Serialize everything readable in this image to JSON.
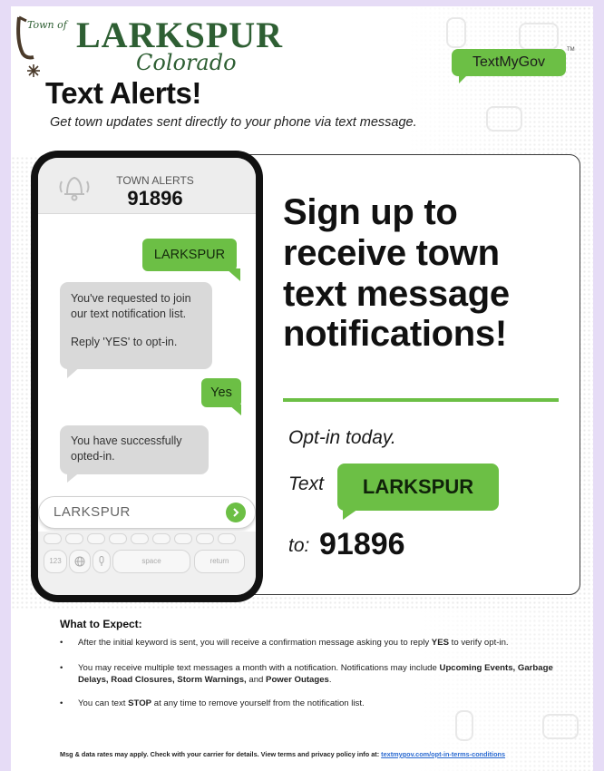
{
  "header": {
    "town_prefix": "Town of",
    "town_name": "LARKSPUR",
    "state": "Colorado",
    "title": "Text Alerts!",
    "subtitle": "Get town updates sent directly to your phone via text message.",
    "brand": "TextMyGov",
    "brand_tm": "TM"
  },
  "phone": {
    "alerts_label": "TOWN ALERTS",
    "shortcode": "91896",
    "messages": [
      {
        "from": "user",
        "text": "LARKSPUR"
      },
      {
        "from": "town",
        "text": "You've requested to join our text notification list.",
        "text2": "Reply 'YES' to opt-in."
      },
      {
        "from": "user",
        "text": "Yes"
      },
      {
        "from": "town",
        "text": "You have successfully opted-in."
      }
    ],
    "input_value": "LARKSPUR",
    "keys": {
      "num": "123",
      "space": "space",
      "return": "return"
    }
  },
  "signup": {
    "headline_lines": [
      "Sign up to",
      "receive town",
      "text message",
      "notifications!"
    ],
    "optin": "Opt-in today.",
    "text_label": "Text",
    "keyword": "LARKSPUR",
    "to_label": "to:",
    "number": "91896"
  },
  "expect": {
    "title": "What to Expect:",
    "bullet": "•",
    "item1_a": "After the initial keyword is sent, you will receive a confirmation message asking you to reply ",
    "item1_b": "YES",
    "item1_c": " to verify opt-in.",
    "item2_a": "You may receive multiple text messages a month with a notification. Notifications may include ",
    "item2_b": "Upcoming Events, Garbage Delays, Road Closures, Storm Warnings,",
    "item2_c": " and ",
    "item2_d": "Power Outages",
    "item2_e": ".",
    "item3_a": "You can text ",
    "item3_b": "STOP",
    "item3_c": " at any time to remove yourself from the notification list."
  },
  "footer": {
    "text": "Msg & data rates may apply. Check with your carrier for details. View terms and privacy policy info at: ",
    "link": "textmygov.com/opt-in-terms-conditions"
  },
  "colors": {
    "accent_green": "#6cbf45",
    "logo_green": "#2e5f33",
    "background": "#e6dcf6"
  }
}
